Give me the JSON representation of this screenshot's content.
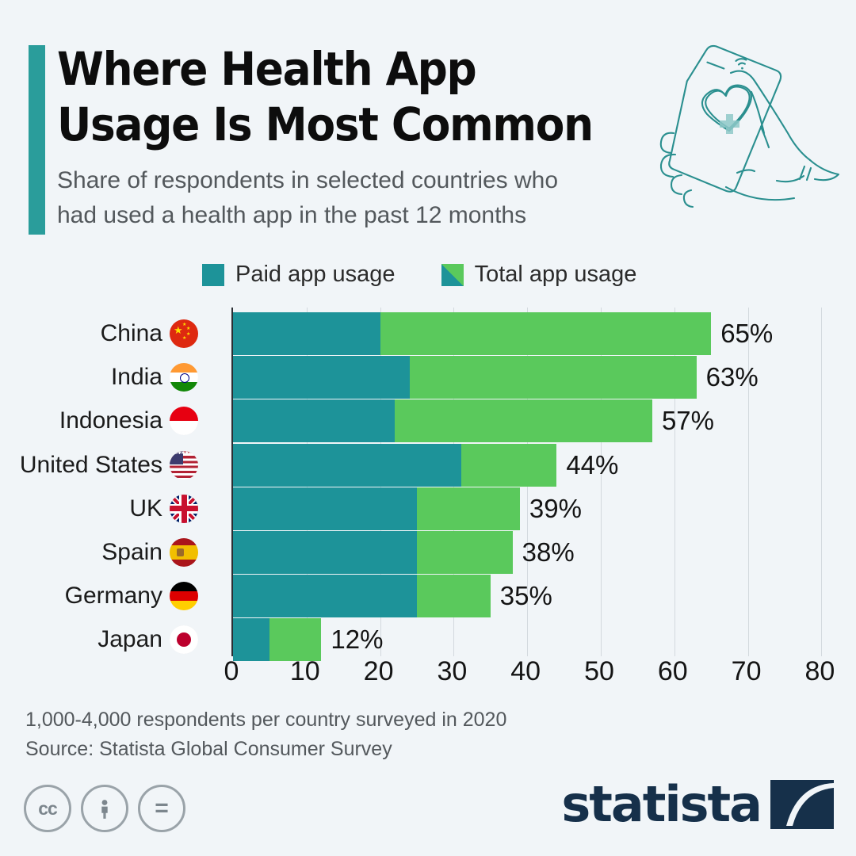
{
  "header": {
    "title": "Where Health App\nUsage Is Most Common",
    "subtitle": "Share of respondents in selected countries who\nhad used a health app in the past 12 months",
    "accent_color": "#2a9d9b",
    "illustration": "hand-holding-phone-with-heart-health-icon"
  },
  "legend": {
    "items": [
      {
        "label": "Paid app usage",
        "color": "#1d9399",
        "swatch_style": "solid"
      },
      {
        "label": "Total app usage",
        "color": "#5ac95c",
        "swatch_style": "split-diagonal"
      }
    ]
  },
  "footer": {
    "note": "1,000-4,000 respondents per country surveyed in 2020",
    "source": "Source: Statista Global Consumer Survey",
    "licenses": [
      {
        "name": "creative-commons",
        "glyph": "cc"
      },
      {
        "name": "attribution",
        "glyph": "person"
      },
      {
        "name": "no-derivatives",
        "glyph": "="
      }
    ],
    "brand": "statista",
    "brand_color": "#16304a"
  },
  "chart_data": {
    "type": "bar",
    "orientation": "horizontal",
    "stacked": true,
    "title": "Where Health App Usage Is Most Common",
    "subtitle": "Share of respondents in selected countries who had used a health app in the past 12 months",
    "xlabel": "",
    "ylabel": "",
    "xlim": [
      0,
      80
    ],
    "xticks": [
      0,
      10,
      20,
      30,
      40,
      50,
      60,
      70,
      80
    ],
    "grid": true,
    "legend_position": "top",
    "unit": "%",
    "categories": [
      "China",
      "India",
      "Indonesia",
      "United States",
      "UK",
      "Spain",
      "Germany",
      "Japan"
    ],
    "flags": [
      "cn",
      "in",
      "id",
      "us",
      "gb",
      "es",
      "de",
      "jp"
    ],
    "series": [
      {
        "name": "Paid app usage",
        "color": "#1d9399",
        "values": [
          20,
          24,
          22,
          31,
          25,
          25,
          25,
          5
        ]
      },
      {
        "name": "Total app usage",
        "color": "#5ac95c",
        "values": [
          65,
          63,
          57,
          44,
          39,
          38,
          35,
          12
        ]
      }
    ],
    "data_labels": [
      "65%",
      "63%",
      "57%",
      "44%",
      "39%",
      "38%",
      "35%",
      "12%"
    ]
  }
}
